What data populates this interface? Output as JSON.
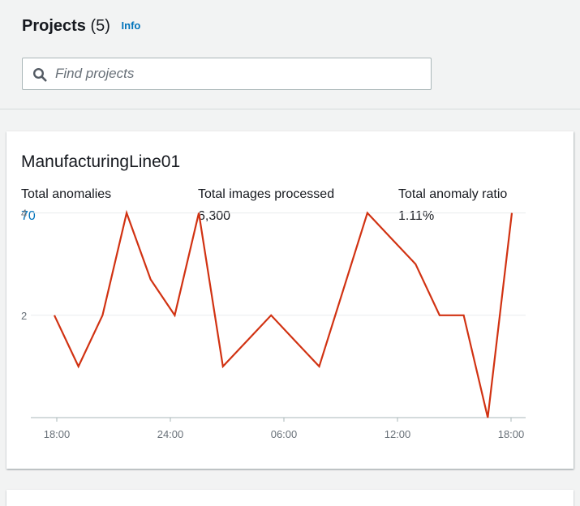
{
  "header": {
    "title": "Projects",
    "count": "(5)",
    "info_link": "Info"
  },
  "search": {
    "placeholder": "Find projects",
    "value": ""
  },
  "project_card": {
    "name": "ManufacturingLine01",
    "metrics": [
      {
        "label": "Total anomalies",
        "value": "70"
      },
      {
        "label": "Total images processed",
        "value": "6,300"
      },
      {
        "label": "Total anomaly ratio",
        "value": "1.11%"
      }
    ]
  },
  "colors": {
    "link": "#0073bb",
    "series_line": "#d13212",
    "page_background": "#f2f3f3"
  },
  "chart_data": {
    "type": "line",
    "title": "",
    "xlabel": "",
    "ylabel": "",
    "x_ticks": [
      "18:00",
      "24:00",
      "06:00",
      "12:00",
      "18:00"
    ],
    "y_ticks": [
      2,
      4
    ],
    "ylim": [
      0,
      4.2
    ],
    "grid": true,
    "series": [
      {
        "values": [
          2,
          1,
          2,
          4,
          2.7,
          2,
          4,
          1,
          1.5,
          2,
          1.5,
          1,
          2.5,
          4,
          3.5,
          3,
          2,
          2,
          0,
          4
        ]
      }
    ]
  }
}
